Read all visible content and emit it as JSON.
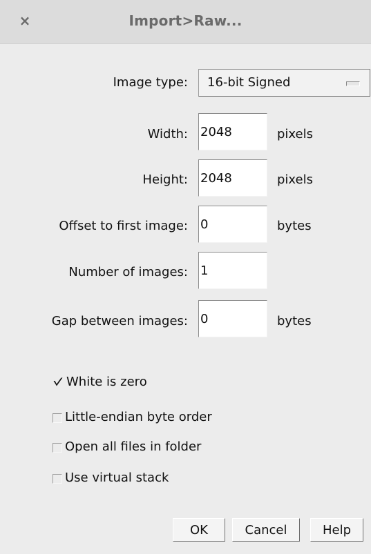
{
  "window": {
    "title": "Import>Raw...",
    "close_icon": "×"
  },
  "form": {
    "image_type": {
      "label": "Image type:",
      "value": "16-bit Signed"
    },
    "width": {
      "label": "Width:",
      "value": "2048",
      "unit": "pixels"
    },
    "height": {
      "label": "Height:",
      "value": "2048",
      "unit": "pixels"
    },
    "offset": {
      "label": "Offset to first image:",
      "value": "0",
      "unit": "bytes"
    },
    "number_of_images": {
      "label": "Number of images:",
      "value": "1"
    },
    "gap": {
      "label": "Gap between images:",
      "value": "0",
      "unit": "bytes"
    }
  },
  "options": [
    {
      "label": "White is zero",
      "checked": true
    },
    {
      "label": "Little-endian byte order",
      "checked": false
    },
    {
      "label": "Open all files in folder",
      "checked": false
    },
    {
      "label": "Use virtual stack",
      "checked": false
    }
  ],
  "buttons": {
    "ok": "OK",
    "cancel": "Cancel",
    "help": "Help"
  }
}
